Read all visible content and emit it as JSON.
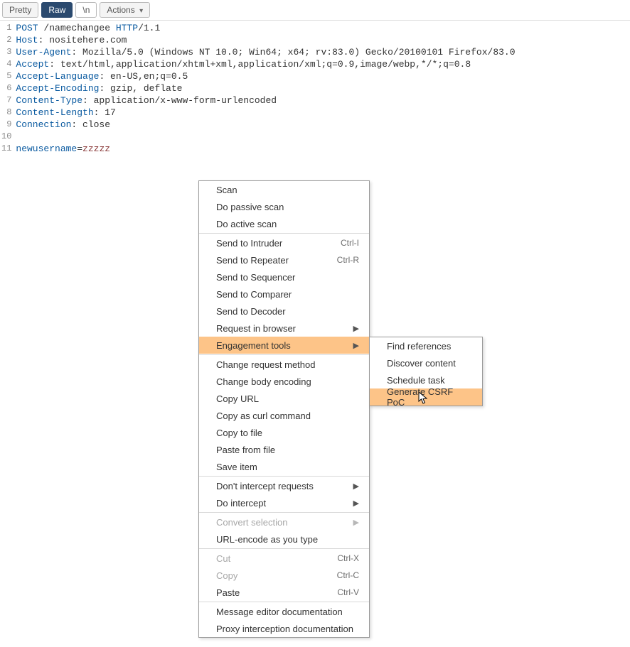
{
  "toolbar": {
    "pretty": "Pretty",
    "raw": "Raw",
    "newline": "\\n",
    "actions": "Actions"
  },
  "request": {
    "lines": [
      {
        "n": 1,
        "segs": [
          {
            "t": "POST ",
            "c": "hdr"
          },
          {
            "t": "/namechangee ",
            "c": "val"
          },
          {
            "t": "HTTP",
            "c": "hdr"
          },
          {
            "t": "/",
            "c": "val"
          },
          {
            "t": "1.1",
            "c": "val"
          }
        ]
      },
      {
        "n": 2,
        "segs": [
          {
            "t": "Host",
            "c": "hdr"
          },
          {
            "t": ": nositehere.com",
            "c": "val"
          }
        ]
      },
      {
        "n": 3,
        "segs": [
          {
            "t": "User-Agent",
            "c": "hdr"
          },
          {
            "t": ": Mozilla/5.0 (Windows NT 10.0; Win64; x64; rv:83.0) Gecko/20100101 Firefox/83.0",
            "c": "val"
          }
        ]
      },
      {
        "n": 4,
        "segs": [
          {
            "t": "Accept",
            "c": "hdr"
          },
          {
            "t": ": text/html,application/xhtml+xml,application/xml;q=0.9,image/webp,*/*;q=0.8",
            "c": "val"
          }
        ]
      },
      {
        "n": 5,
        "segs": [
          {
            "t": "Accept-Language",
            "c": "hdr"
          },
          {
            "t": ": en-US,en;q=0.5",
            "c": "val"
          }
        ]
      },
      {
        "n": 6,
        "segs": [
          {
            "t": "Accept-Encoding",
            "c": "hdr"
          },
          {
            "t": ": gzip, deflate",
            "c": "val"
          }
        ]
      },
      {
        "n": 7,
        "segs": [
          {
            "t": "Content-Type",
            "c": "hdr"
          },
          {
            "t": ": application/x-www-form-urlencoded",
            "c": "val"
          }
        ]
      },
      {
        "n": 8,
        "segs": [
          {
            "t": "Content-Length",
            "c": "hdr"
          },
          {
            "t": ": 17",
            "c": "val"
          }
        ]
      },
      {
        "n": 9,
        "segs": [
          {
            "t": "Connection",
            "c": "hdr"
          },
          {
            "t": ": close",
            "c": "val"
          }
        ]
      },
      {
        "n": 10,
        "segs": [
          {
            "t": "",
            "c": "val"
          }
        ]
      },
      {
        "n": 11,
        "segs": [
          {
            "t": "newusername",
            "c": "hdr"
          },
          {
            "t": "=",
            "c": "val"
          },
          {
            "t": "zzzzz",
            "c": "rv"
          }
        ]
      }
    ]
  },
  "context_menu": {
    "items": [
      {
        "label": "Scan"
      },
      {
        "label": "Do passive scan"
      },
      {
        "label": "Do active scan"
      },
      {
        "sep": true
      },
      {
        "label": "Send to Intruder",
        "shortcut": "Ctrl-I"
      },
      {
        "label": "Send to Repeater",
        "shortcut": "Ctrl-R"
      },
      {
        "label": "Send to Sequencer"
      },
      {
        "label": "Send to Comparer"
      },
      {
        "label": "Send to Decoder"
      },
      {
        "label": "Request in browser",
        "submenu": true
      },
      {
        "label": "Engagement tools",
        "submenu": true,
        "highlight": true
      },
      {
        "sep": true
      },
      {
        "label": "Change request method"
      },
      {
        "label": "Change body encoding"
      },
      {
        "label": "Copy URL"
      },
      {
        "label": "Copy as curl command"
      },
      {
        "label": "Copy to file"
      },
      {
        "label": "Paste from file"
      },
      {
        "label": "Save item"
      },
      {
        "sep": true
      },
      {
        "label": "Don't intercept requests",
        "submenu": true
      },
      {
        "label": "Do intercept",
        "submenu": true
      },
      {
        "sep": true
      },
      {
        "label": "Convert selection",
        "submenu": true,
        "disabled": true
      },
      {
        "label": "URL-encode as you type"
      },
      {
        "sep": true
      },
      {
        "label": "Cut",
        "shortcut": "Ctrl-X",
        "disabled": true
      },
      {
        "label": "Copy",
        "shortcut": "Ctrl-C",
        "disabled": true
      },
      {
        "label": "Paste",
        "shortcut": "Ctrl-V"
      },
      {
        "sep": true
      },
      {
        "label": "Message editor documentation"
      },
      {
        "label": "Proxy interception documentation"
      }
    ]
  },
  "submenu": {
    "items": [
      {
        "label": "Find references"
      },
      {
        "label": "Discover content"
      },
      {
        "label": "Schedule task"
      },
      {
        "label": "Generate CSRF PoC",
        "highlight": true
      }
    ]
  }
}
